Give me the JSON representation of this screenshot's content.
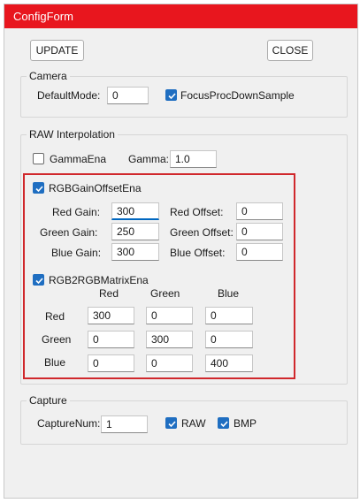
{
  "window": {
    "title": "ConfigForm"
  },
  "toolbar": {
    "update_label": "UPDATE",
    "close_label": "CLOSE"
  },
  "camera": {
    "title": "Camera",
    "default_mode_label": "DefaultMode:",
    "default_mode_value": "0",
    "focus_proc_label": "FocusProcDownSample",
    "focus_proc_checked": true
  },
  "raw": {
    "title": "RAW Interpolation",
    "gamma_ena_label": "GammaEna",
    "gamma_ena_checked": false,
    "gamma_label": "Gamma:",
    "gamma_value": "1.0",
    "gain_offset_label": "RGBGainOffsetEna",
    "gain_offset_checked": true,
    "red_gain_label": "Red Gain:",
    "red_gain_value": "300",
    "green_gain_label": "Green Gain:",
    "green_gain_value": "250",
    "blue_gain_label": "Blue Gain:",
    "blue_gain_value": "300",
    "red_offset_label": "Red Offset:",
    "red_offset_value": "0",
    "green_offset_label": "Green Offset:",
    "green_offset_value": "0",
    "blue_offset_label": "Blue Offset:",
    "blue_offset_value": "0",
    "matrix_label": "RGB2RGBMatrixEna",
    "matrix_checked": true,
    "matrix_cols": [
      "Red",
      "Green",
      "Blue"
    ],
    "matrix_rows": [
      "Red",
      "Green",
      "Blue"
    ],
    "matrix_values": [
      [
        "300",
        "0",
        "0"
      ],
      [
        "0",
        "300",
        "0"
      ],
      [
        "0",
        "0",
        "400"
      ]
    ]
  },
  "capture": {
    "title": "Capture",
    "capture_num_label": "CaptureNum:",
    "capture_num_value": "1",
    "raw_label": "RAW",
    "raw_checked": true,
    "bmp_label": "BMP",
    "bmp_checked": true
  },
  "colors": {
    "titlebar": "#e8161e",
    "accent": "#1f6ec1",
    "highlight": "#d0282c"
  }
}
